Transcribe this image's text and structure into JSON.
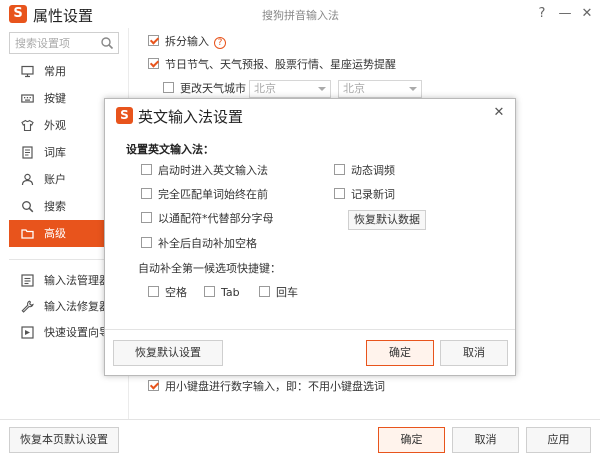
{
  "window": {
    "title": "属性设置",
    "subtitle": "搜狗拼音输入法",
    "help_button": "?",
    "minimize_button": "—",
    "close_button": "✕",
    "logo_text": "S",
    "accent": "#e8541c"
  },
  "sidebar": {
    "search_placeholder": "搜索设置项",
    "items": [
      {
        "label": "常用",
        "icon": "monitor-icon",
        "active": false
      },
      {
        "label": "按键",
        "icon": "keyboard-icon",
        "active": false
      },
      {
        "label": "外观",
        "icon": "tshirt-icon",
        "active": false
      },
      {
        "label": "词库",
        "icon": "book-icon",
        "active": false
      },
      {
        "label": "账户",
        "icon": "user-icon",
        "active": false
      },
      {
        "label": "搜索",
        "icon": "magnifier-icon",
        "active": false
      },
      {
        "label": "高级",
        "icon": "folder-icon",
        "active": true
      }
    ],
    "tools": [
      {
        "label": "输入法管理器",
        "icon": "list-icon"
      },
      {
        "label": "输入法修复器",
        "icon": "wrench-icon"
      },
      {
        "label": "快速设置向导",
        "icon": "wizard-icon"
      }
    ]
  },
  "content": {
    "split_input": {
      "label": "拆分输入",
      "checked": true,
      "help_icon": "?"
    },
    "festival": {
      "label": "节日节气、天气预报、股票行情、星座运势提醒",
      "checked": true
    },
    "weather_city": {
      "label": "更改天气城市",
      "checked": false,
      "province": "北京",
      "city": "北京"
    },
    "keypad_digits": {
      "label": "用小键盘进行数字输入，即：不用小键盘选词",
      "checked": true
    }
  },
  "footer": {
    "restore_page": "恢复本页默认设置",
    "ok": "确定",
    "cancel": "取消",
    "apply": "应用"
  },
  "dialog": {
    "title": "英文输入法设置",
    "logo_text": "S",
    "close_button": "✕",
    "heading": "设置英文输入法：",
    "left_options": [
      {
        "label": "启动时进入英文输入法",
        "checked": false
      },
      {
        "label": "完全匹配单词始终在前",
        "checked": false
      },
      {
        "label": "以通配符*代替部分字母",
        "checked": false
      },
      {
        "label": "补全后自动补加空格",
        "checked": false
      }
    ],
    "right_options": [
      {
        "label": "动态调频",
        "checked": false
      },
      {
        "label": "记录新词",
        "checked": false
      }
    ],
    "restore_data_button": "恢复默认数据",
    "shortcut_label": "自动补全第一候选项快捷键：",
    "shortcut_options": [
      {
        "label": "空格",
        "checked": false
      },
      {
        "label": "Tab",
        "checked": false
      },
      {
        "label": "回车",
        "checked": false
      }
    ],
    "restore_default_button": "恢复默认设置",
    "ok_button": "确定",
    "cancel_button": "取消"
  }
}
